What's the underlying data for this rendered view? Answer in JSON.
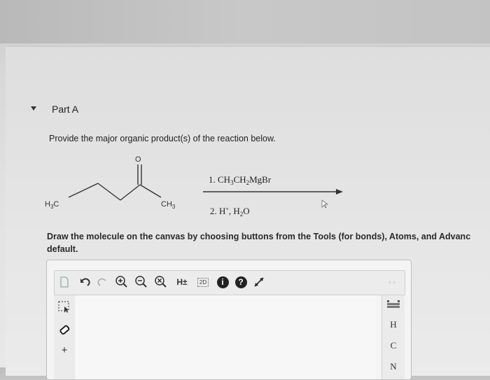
{
  "part": {
    "title": "Part A"
  },
  "question": {
    "prompt": "Provide the major organic product(s) of the reaction below.",
    "reagent1_prefix": "1. CH",
    "reagent1_parts": [
      "3",
      "CH",
      "2",
      "MgBr"
    ],
    "reagent2_prefix": "2. H",
    "reagent2_sup": "+",
    "reagent2_mid": ", H",
    "reagent2_sub": "2",
    "reagent2_suffix": "O",
    "molecule": {
      "oxygen": "O",
      "left_group_main": "H",
      "left_group_sub": "3",
      "left_group_end": "C",
      "right_group_main": "CH",
      "right_group_sub": "3"
    },
    "instructions_line1": "Draw the molecule on the canvas by choosing buttons from the Tools (for bonds), Atoms, and Advanc",
    "instructions_line2": "default."
  },
  "editor": {
    "toolbar": {
      "h_toggle_label": "H±",
      "view_2d_label": "2D",
      "info_label": "i",
      "help_label": "?"
    },
    "left_tools": {
      "charge_plus_label": "+"
    },
    "atoms": [
      "H",
      "C",
      "N"
    ],
    "nav_arrows_label": "‹ ›"
  }
}
